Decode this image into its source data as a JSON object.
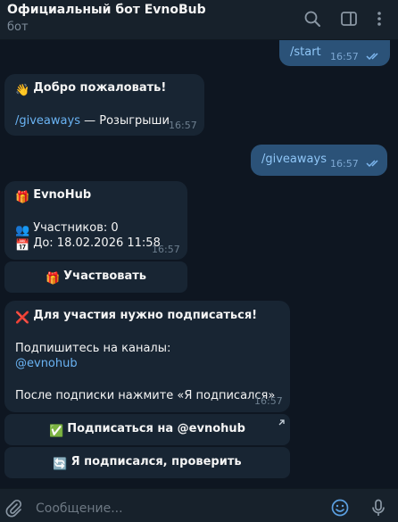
{
  "header": {
    "title": "Официальный бот EvnoBub",
    "subtitle": "бот"
  },
  "messages": {
    "start": {
      "text": "/start",
      "time": "16:57"
    },
    "welcome": {
      "greeting_emoji": "👋",
      "title": "Добро пожаловать!",
      "command": "/giveaways",
      "command_desc": " — Розыгрыши",
      "time": "16:57"
    },
    "giveaways": {
      "text": "/giveaways",
      "time": "16:57"
    },
    "giveaway_card": {
      "title_emoji": "🎁",
      "title": "EvnoHub",
      "participants_emoji": "👥",
      "participants": "Участников: 0",
      "until_emoji": "📅",
      "until": "До: 18.02.2026 11:58",
      "time": "16:57",
      "button_emoji": "🎁",
      "button_label": "Участвовать"
    },
    "subscribe": {
      "title_emoji": "❌",
      "title": "Для участия нужно подписаться!",
      "line1": "Подпишитесь на каналы:",
      "channel": "@evnohub",
      "line2": "После подписки нажмите «Я подписался»",
      "time": "16:57",
      "button1_emoji": "✅",
      "button1_label": "Подписаться на @evnohub",
      "button2_emoji": "🔄",
      "button2_label": "Я подписался, проверить"
    }
  },
  "input": {
    "placeholder": "Сообщение..."
  },
  "icons": {
    "search": "search-icon",
    "sidebar": "sidebar-toggle-icon",
    "more": "more-vertical-icon",
    "attach": "paperclip-icon",
    "emoji": "emoji-icon",
    "mic": "microphone-icon",
    "read": "double-check-icon",
    "external": "external-link-icon"
  },
  "colors": {
    "background": "#0e1621",
    "header": "#17212b",
    "incoming": "#182533",
    "outgoing": "#2b5278",
    "link": "#6ab3f3"
  }
}
